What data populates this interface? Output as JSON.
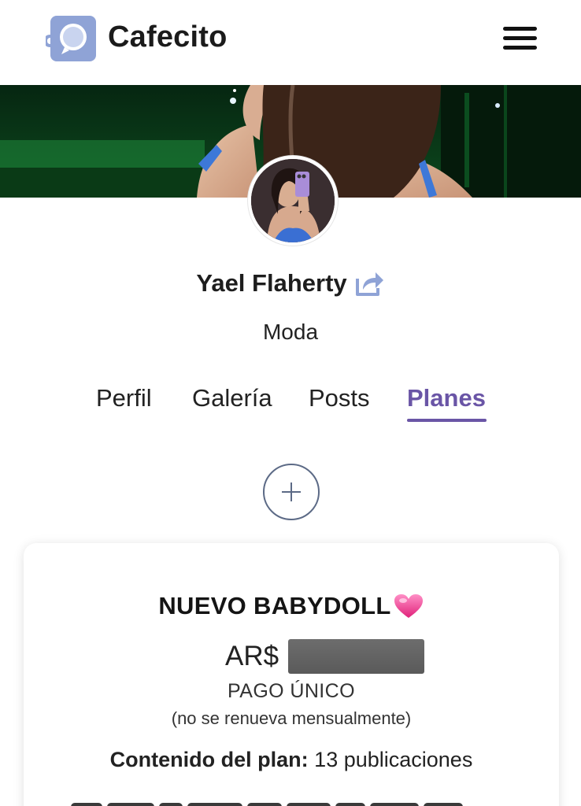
{
  "app": {
    "name": "Cafecito"
  },
  "header": {
    "logo_icon": "cafecito-cup-icon",
    "menu_icon": "hamburger-menu-icon"
  },
  "profile": {
    "name": "Yael Flaherty",
    "category": "Moda",
    "share_icon": "share-icon"
  },
  "tabs": [
    {
      "label": "Perfil",
      "active": false
    },
    {
      "label": "Galería",
      "active": false
    },
    {
      "label": "Posts",
      "active": false
    },
    {
      "label": "Planes",
      "active": true
    }
  ],
  "add_button_icon": "plus-icon",
  "plan": {
    "title": "NUEVO BABYDOLL",
    "title_emoji_icon": "sparkling-heart-icon",
    "currency": "AR$",
    "price_redacted": true,
    "payment_type": "PAGO ÚNICO",
    "payment_note": "(no se renueva mensualmente)",
    "content_label": "Contenido del plan:",
    "content_value": "13 publicaciones"
  },
  "colors": {
    "accent": "#6a55a6",
    "logo_blue": "#8fa3d6",
    "plus_ring": "#5c6a86"
  }
}
